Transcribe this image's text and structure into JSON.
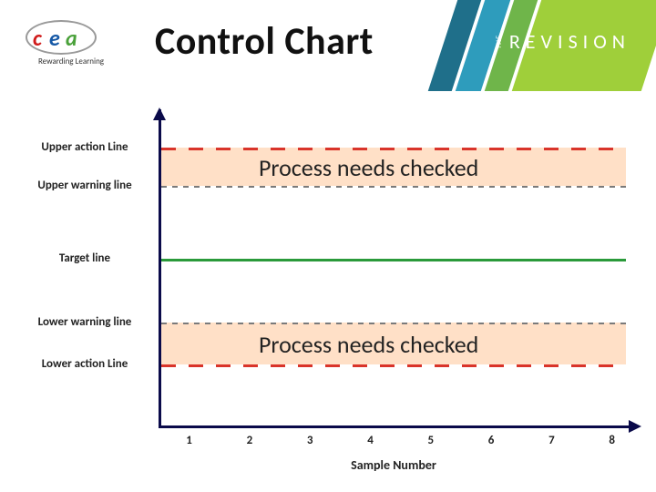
{
  "header": {
    "title": "Control Chart",
    "logo_label": "Rewarding Learning",
    "revision_small": "THE",
    "revision_big": "REVISION"
  },
  "chart_data": {
    "type": "line",
    "title": "Control Chart",
    "xlabel": "Sample Number",
    "ylabel": "",
    "x_ticks": [
      "1",
      "2",
      "3",
      "4",
      "5",
      "6",
      "7",
      "8"
    ],
    "levels": {
      "upper_action": {
        "label": "Upper action Line",
        "y_rel": 0.12
      },
      "upper_warning": {
        "label": "Upper warning line",
        "y_rel": 0.24
      },
      "target": {
        "label": "Target line",
        "y_rel": 0.47
      },
      "lower_warning": {
        "label": "Lower warning line",
        "y_rel": 0.67
      },
      "lower_action": {
        "label": "Lower action Line",
        "y_rel": 0.8
      }
    },
    "bands": [
      {
        "from": "upper_action",
        "to": "upper_warning",
        "label": "Process needs checked"
      },
      {
        "from": "lower_warning",
        "to": "lower_action",
        "label": "Process needs checked"
      }
    ]
  }
}
